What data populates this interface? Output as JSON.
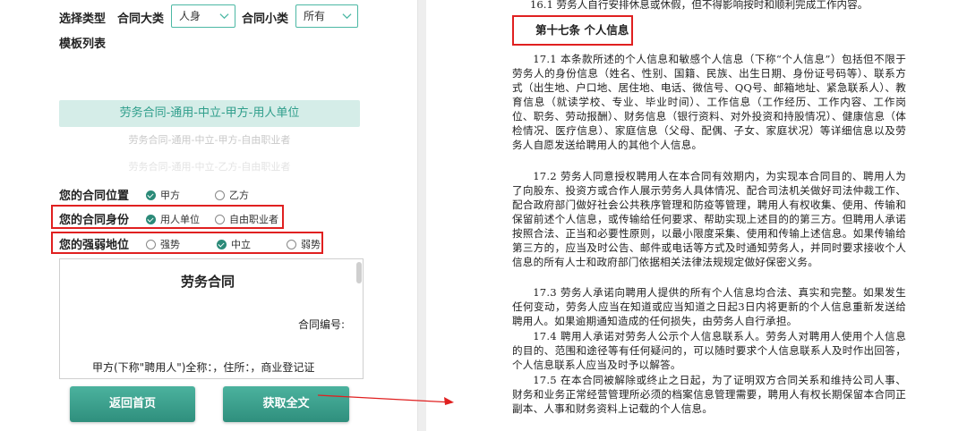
{
  "filters": {
    "type_label": "选择类型",
    "category_label": "合同大类",
    "category_value": "人身",
    "subcategory_label": "合同小类",
    "subcategory_value": "所有"
  },
  "template_list": {
    "label": "模板列表",
    "items": [
      "劳务合同-通用-中立-甲方-用人单位",
      "劳务合同-通用-中立-甲方-自由职业者",
      "劳务合同-通用-中立-乙方-自由职业者"
    ]
  },
  "options": {
    "position": {
      "label": "您的合同位置",
      "choices": [
        "甲方",
        "乙方"
      ],
      "selected": 0
    },
    "identity": {
      "label": "您的合同身份",
      "choices": [
        "用人单位",
        "自由职业者"
      ],
      "selected": 0
    },
    "strength": {
      "label": "您的强弱地位",
      "choices": [
        "强势",
        "中立",
        "弱势"
      ],
      "selected": 1
    }
  },
  "preview": {
    "title": "劳务合同",
    "contract_no": "合同编号:",
    "party_a": "甲方(下称\"聘用人\")全称：，住所：，商业登记证"
  },
  "buttons": {
    "home": "返回首页",
    "full_text": "获取全文"
  },
  "colors": {
    "accent": "#2f9e8b",
    "highlight_box": "#e02020"
  },
  "document": {
    "top_line": "16.1 劳务人自行安排休息或休假，但不得影响按时和顺利完成工作内容。",
    "article_title": "第十七条 个人信息",
    "paragraphs": [
      "17.1 本条款所述的个人信息和敏感个人信息（下称“个人信息”）包括但不限于劳务人的身份信息（姓名、性别、国籍、民族、出生日期、身份证号码等）、联系方式（出生地、户口地、居住地、电话、微信号、QQ号、邮箱地址、紧急联系人）、教育信息（就读学校、专业、毕业时间）、工作信息（工作经历、工作内容、工作岗位、职务、劳动报酬）、财务信息（银行资料、对外投资和持股情况）、健康信息（体检情况、医疗信息）、家庭信息（父母、配偶、子女、家庭状况）等详细信息以及劳务人自愿发送给聘用人的其他个人信息。",
      "17.2 劳务人同意授权聘用人在本合同有效期内，为实现本合同目的、聘用人为了向股东、投资方或合作人展示劳务人具体情况、配合司法机关做好司法仲裁工作、配合政府部门做好社会公共秩序管理和防疫等管理，聘用人有权收集、使用、传输和保留前述个人信息，或传输给任何要求、帮助实现上述目的的第三方。但聘用人承诺按照合法、正当和必要性原则，以最小限度采集、使用和传输上述信息。如果传输给第三方的，应当及时公告、邮件或电话等方式及时通知劳务人，并同时要求接收个人信息的所有人士和政府部门依据相关法律法规规定做好保密义务。",
      "17.3 劳务人承诺向聘用人提供的所有个人信息均合法、真实和完整。如果发生任何变动，劳务人应当在知道或应当知道之日起3日内将更新的个人信息重新发送给聘用人。如果逾期通知造成的任何损失，由劳务人自行承担。",
      "17.4 聘用人承诺对劳务人公示个人信息联系人。劳务人对聘用人使用个人信息的目的、范围和途径等有任何疑问的，可以随时要求个人信息联系人及时作出回答，个人信息联系人应当及时予以解答。",
      "17.5 在本合同被解除或终止之日起，为了证明双方合同关系和维持公司人事、财务和业务正常经营管理所必须的档案信息管理需要，聘用人有权长期保留本合同正副本、人事和财务资料上记载的个人信息。"
    ]
  }
}
